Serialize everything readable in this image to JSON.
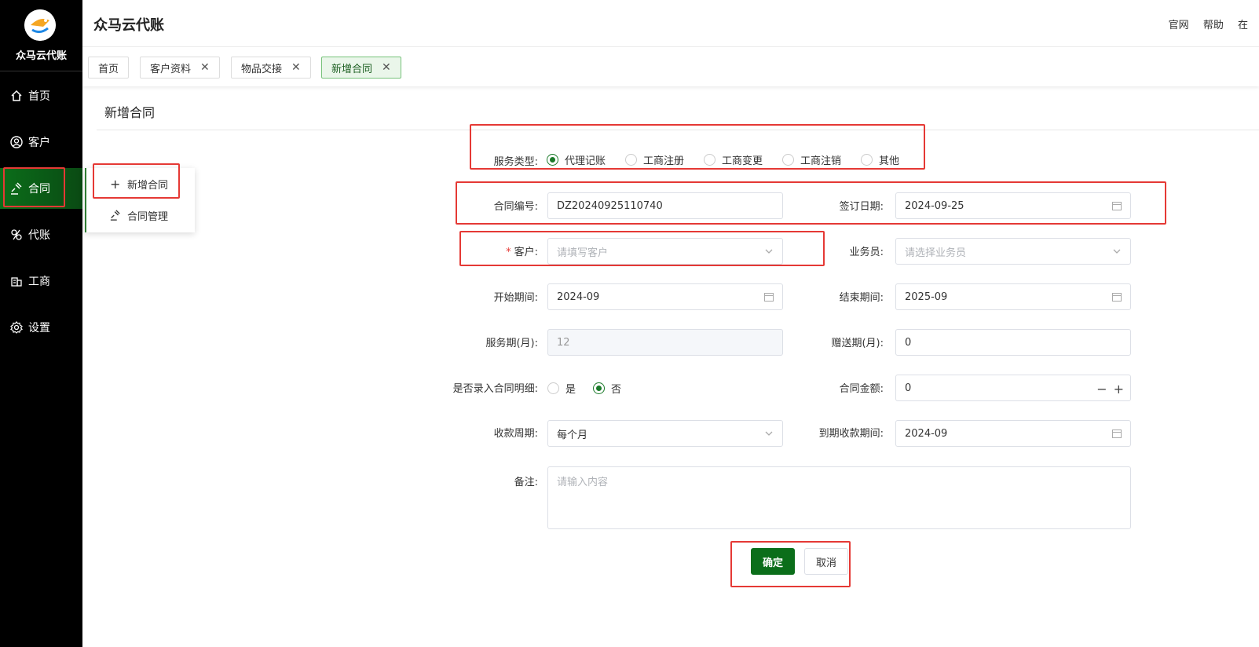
{
  "sidebar": {
    "logo_text": "众马云代账",
    "items": [
      {
        "label": "首页",
        "icon": "home-icon"
      },
      {
        "label": "客户",
        "icon": "user-circle-icon"
      },
      {
        "label": "合同",
        "icon": "gavel-icon"
      },
      {
        "label": "代账",
        "icon": "accounting-icon"
      },
      {
        "label": "工商",
        "icon": "building-icon"
      },
      {
        "label": "设置",
        "icon": "gear-icon"
      }
    ],
    "active_index": 2
  },
  "header": {
    "title": "众马云代账",
    "links": [
      "官网",
      "帮助",
      "在"
    ]
  },
  "tabs": [
    {
      "label": "首页",
      "closable": false
    },
    {
      "label": "客户资料",
      "closable": true
    },
    {
      "label": "物品交接",
      "closable": true
    },
    {
      "label": "新增合同",
      "closable": true,
      "active": true
    }
  ],
  "submenu": {
    "items": [
      {
        "label": "新增合同",
        "icon": "plus-icon"
      },
      {
        "label": "合同管理",
        "icon": "gavel-icon"
      }
    ]
  },
  "page": {
    "title": "新增合同"
  },
  "form": {
    "service_type": {
      "label": "服务类型:",
      "options": [
        "代理记账",
        "工商注册",
        "工商变更",
        "工商注销",
        "其他"
      ],
      "selected": "代理记账"
    },
    "contract_no": {
      "label": "合同编号:",
      "value": "DZ20240925110740"
    },
    "sign_date": {
      "label": "签订日期:",
      "value": "2024-09-25"
    },
    "customer": {
      "label": "客户:",
      "required": "*",
      "placeholder": "请填写客户"
    },
    "salesperson": {
      "label": "业务员:",
      "placeholder": "请选择业务员"
    },
    "start_period": {
      "label": "开始期间:",
      "value": "2024-09"
    },
    "end_period": {
      "label": "结束期间:",
      "value": "2025-09"
    },
    "service_months": {
      "label": "服务期(月):",
      "value": "12"
    },
    "gift_months": {
      "label": "赠送期(月):",
      "value": "0"
    },
    "detail_entry": {
      "label": "是否录入合同明细:",
      "options": [
        "是",
        "否"
      ],
      "selected": "否"
    },
    "amount": {
      "label": "合同金额:",
      "value": "0",
      "minus": "−",
      "plus": "+"
    },
    "payment_cycle": {
      "label": "收款周期:",
      "value": "每个月"
    },
    "due_period": {
      "label": "到期收款期间:",
      "value": "2024-09"
    },
    "remark": {
      "label": "备注:",
      "placeholder": "请输入内容"
    }
  },
  "actions": {
    "confirm": "确定",
    "cancel": "取消"
  },
  "colors": {
    "primary": "#0b6e1a",
    "highlight": "#e53935",
    "sidebar_bg": "#000000"
  }
}
